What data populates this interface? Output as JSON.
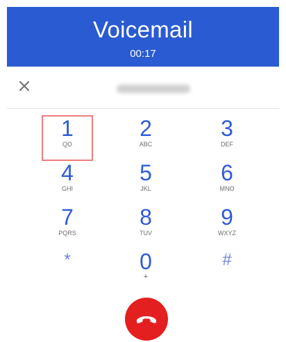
{
  "header": {
    "title": "Voicemail",
    "timer": "00:17"
  },
  "input": {
    "close_icon": "close-icon"
  },
  "dialpad": {
    "keys": [
      {
        "digit": "1",
        "letters": "QO"
      },
      {
        "digit": "2",
        "letters": "ABC"
      },
      {
        "digit": "3",
        "letters": "DEF"
      },
      {
        "digit": "4",
        "letters": "GHI"
      },
      {
        "digit": "5",
        "letters": "JKL"
      },
      {
        "digit": "6",
        "letters": "MNO"
      },
      {
        "digit": "7",
        "letters": "PQRS"
      },
      {
        "digit": "8",
        "letters": "TUV"
      },
      {
        "digit": "9",
        "letters": "WXYZ"
      },
      {
        "digit": "*",
        "letters": ""
      },
      {
        "digit": "0",
        "letters": "+"
      },
      {
        "digit": "#",
        "letters": ""
      }
    ],
    "highlighted_key": "1"
  },
  "end_call": {
    "icon": "phone-hangup-icon",
    "color": "#e41f1f"
  },
  "colors": {
    "header_bg": "#2a5bd2",
    "key_text": "#2f5bd6",
    "highlight_border": "#f07c7c"
  }
}
